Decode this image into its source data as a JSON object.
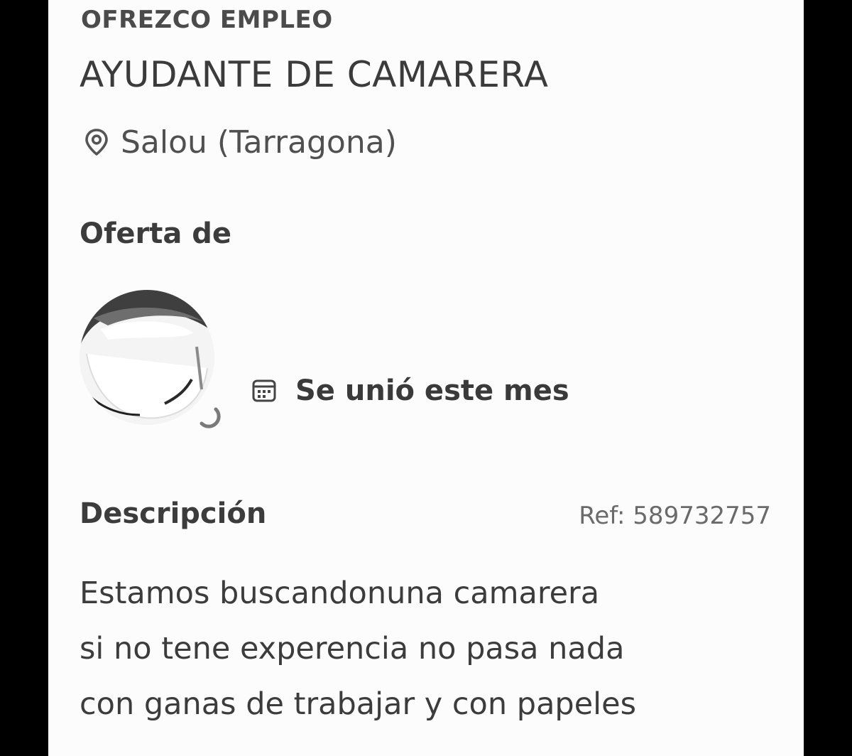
{
  "listing": {
    "category": "OFREZCO EMPLEO",
    "title": "AYUDANTE DE CAMARERA",
    "location": "Salou (Tarragona)",
    "location_icon": "location-pin-icon"
  },
  "seller": {
    "section_title": "Oferta de",
    "joined_icon": "calendar-icon",
    "joined_text": "Se unió este mes"
  },
  "description": {
    "section_title": "Descripción",
    "ref": "Ref: 589732757",
    "lines": [
      "Estamos buscandonuna camarera",
      "si no tene experencia no pasa nada",
      "con ganas de trabajar y con papeles"
    ]
  },
  "colors": {
    "background": "#fcfcfc",
    "text": "#3a3a3a",
    "muted": "#6a6a6a",
    "frame": "#000000"
  }
}
